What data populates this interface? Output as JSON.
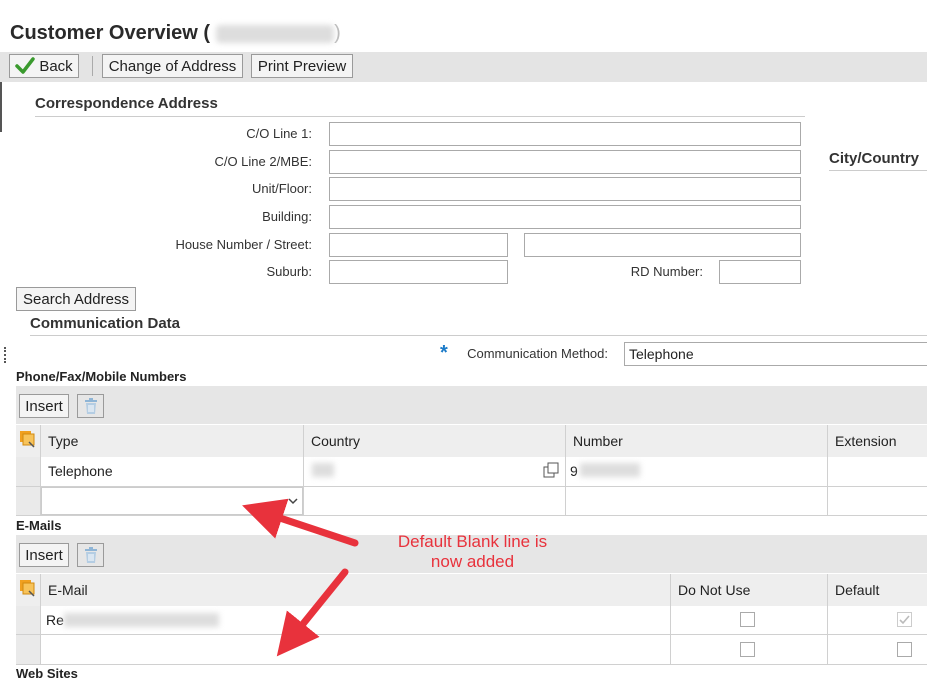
{
  "page": {
    "title": "Customer Overview (",
    "title_close": ")"
  },
  "toolbar": {
    "back_label": "Back",
    "change_address_label": "Change of Address",
    "print_preview_label": "Print Preview"
  },
  "correspondence": {
    "heading": "Correspondence Address",
    "co_line1_label": "C/O Line 1:",
    "co_line2_label": "C/O Line 2/MBE:",
    "unit_floor_label": "Unit/Floor:",
    "building_label": "Building:",
    "house_street_label": "House Number / Street:",
    "suburb_label": "Suburb:",
    "rd_number_label": "RD Number:",
    "city_country_heading": "City/Country",
    "search_address_label": "Search Address"
  },
  "communication": {
    "heading": "Communication Data",
    "required_mark": "*",
    "method_label": "Communication Method:",
    "method_value": "Telephone"
  },
  "phones": {
    "heading": "Phone/Fax/Mobile Numbers",
    "insert_label": "Insert",
    "columns": [
      "Type",
      "Country",
      "Number",
      "Extension"
    ],
    "rows": [
      {
        "type": "Telephone",
        "number_prefix": "9"
      }
    ]
  },
  "emails": {
    "heading": "E-Mails",
    "insert_label": "Insert",
    "columns": [
      "E-Mail",
      "Do Not Use",
      "Default"
    ],
    "rows": [
      {
        "email_prefix": "Re",
        "do_not_use": false,
        "default": true
      }
    ]
  },
  "websites": {
    "heading": "Web Sites"
  },
  "annotation": {
    "line1": "Default Blank line is",
    "line2": "now added",
    "color": "#e8323c"
  },
  "icons": {
    "back": "checkmark-icon",
    "trash": "trash-icon",
    "table_settings": "table-settings-icon",
    "value_help": "copy-icon",
    "dropdown": "chevron-down-icon"
  }
}
